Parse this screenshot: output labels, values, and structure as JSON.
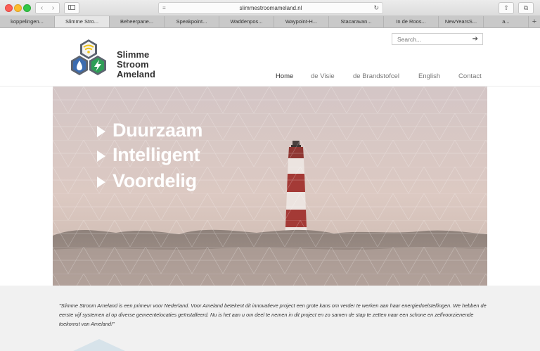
{
  "browser": {
    "url": "slimmestroomameland.nl",
    "tabs": [
      {
        "label": "koppelingen..."
      },
      {
        "label": "Slimme Stro..."
      },
      {
        "label": "Beheerpane..."
      },
      {
        "label": "Speakpoint..."
      },
      {
        "label": "Waddenpos..."
      },
      {
        "label": "Waypoint-H..."
      },
      {
        "label": "Stacaravan..."
      },
      {
        "label": "In de Roos..."
      },
      {
        "label": "NewYearsS..."
      },
      {
        "label": "a..."
      },
      {
        "label": "+"
      }
    ]
  },
  "site": {
    "logo_lines": [
      "Slimme",
      "Stroom",
      "Ameland"
    ],
    "search_placeholder": "Search...",
    "nav": [
      {
        "label": "Home"
      },
      {
        "label": "de Visie"
      },
      {
        "label": "de Brandstofcel"
      },
      {
        "label": "English"
      },
      {
        "label": "Contact"
      }
    ],
    "hero": {
      "slogans": [
        "Duurzaam",
        "Intelligent",
        "Voordelig"
      ]
    },
    "quote": "\"Slimme Stroom Ameland is een primeur voor Nederland. Voor Ameland betekent dit innovatieve project een grote kans om verder te werken aan haar energiedoelstellingen. We hebben de eerste vijf systemen al op diverse gemeentelocaties geïnstalleerd. Nu is het aan u om deel te nemen in dit project en zo samen de stap te zetten naar een schone en zelfvoorzienende toekomst van Ameland!\""
  },
  "colors": {
    "logo_gray": "#5d6470",
    "logo_blue": "#3c6cb0",
    "logo_green": "#2f9e57",
    "logo_yellow": "#f0c419",
    "lighthouse_red": "#a43a36",
    "hero_sky": "#d9c8c4"
  },
  "icons": {
    "back": "chevron-left-icon",
    "forward": "chevron-right-icon",
    "sidebar": "sidebar-icon",
    "reader": "reader-icon",
    "reload": "reload-icon",
    "share": "share-icon",
    "tabs": "tabs-overview-icon",
    "search_submit": "arrow-right-icon"
  }
}
